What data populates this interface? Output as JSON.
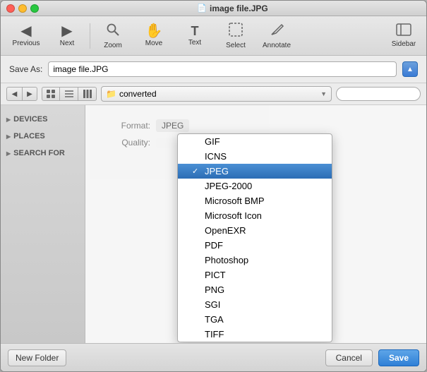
{
  "window": {
    "title": "image file.JPG",
    "doc_icon": "📄"
  },
  "toolbar": {
    "buttons": [
      {
        "id": "previous",
        "icon": "◀",
        "label": "Previous"
      },
      {
        "id": "next",
        "icon": "▶",
        "label": "Next"
      },
      {
        "id": "zoom",
        "icon": "🔍",
        "label": "Zoom"
      },
      {
        "id": "move",
        "icon": "✋",
        "label": "Move"
      },
      {
        "id": "text",
        "icon": "T",
        "label": "Text"
      },
      {
        "id": "select",
        "icon": "⊞",
        "label": "Select"
      },
      {
        "id": "annotate",
        "icon": "✏️",
        "label": "Annotate"
      }
    ],
    "sidebar_label": "Sidebar"
  },
  "saveas": {
    "label": "Save As:",
    "filename": "image file.JPG",
    "disclosure_arrow": "▲"
  },
  "navbar": {
    "back_arrow": "◀",
    "forward_arrow": "▶",
    "view_icons": [
      "⊞",
      "☰",
      "⊟"
    ],
    "location_icon": "📁",
    "location_text": "converted",
    "location_arrow": "▼",
    "search_placeholder": ""
  },
  "sidebar": {
    "sections": [
      {
        "id": "devices",
        "label": "DEVICES"
      },
      {
        "id": "places",
        "label": "PLACES"
      },
      {
        "id": "search",
        "label": "SEARCH FOR"
      }
    ]
  },
  "format_dropdown": {
    "label": "Format:",
    "items": [
      {
        "id": "gif",
        "label": "GIF",
        "selected": false,
        "check": ""
      },
      {
        "id": "icns",
        "label": "ICNS",
        "selected": false,
        "check": ""
      },
      {
        "id": "jpeg",
        "label": "JPEG",
        "selected": true,
        "check": "✓"
      },
      {
        "id": "jpeg2000",
        "label": "JPEG-2000",
        "selected": false,
        "check": ""
      },
      {
        "id": "msft-bmp",
        "label": "Microsoft BMP",
        "selected": false,
        "check": ""
      },
      {
        "id": "msft-icon",
        "label": "Microsoft Icon",
        "selected": false,
        "check": ""
      },
      {
        "id": "openexr",
        "label": "OpenEXR",
        "selected": false,
        "check": ""
      },
      {
        "id": "pdf",
        "label": "PDF",
        "selected": false,
        "check": ""
      },
      {
        "id": "photoshop",
        "label": "Photoshop",
        "selected": false,
        "check": ""
      },
      {
        "id": "pict",
        "label": "PICT",
        "selected": false,
        "check": ""
      },
      {
        "id": "png",
        "label": "PNG",
        "selected": false,
        "check": ""
      },
      {
        "id": "sgi",
        "label": "SGI",
        "selected": false,
        "check": ""
      },
      {
        "id": "tga",
        "label": "TGA",
        "selected": false,
        "check": ""
      },
      {
        "id": "tiff",
        "label": "TIFF",
        "selected": false,
        "check": ""
      }
    ]
  },
  "bottom": {
    "new_folder": "New Folder",
    "cancel": "Cancel",
    "save": "Save"
  }
}
